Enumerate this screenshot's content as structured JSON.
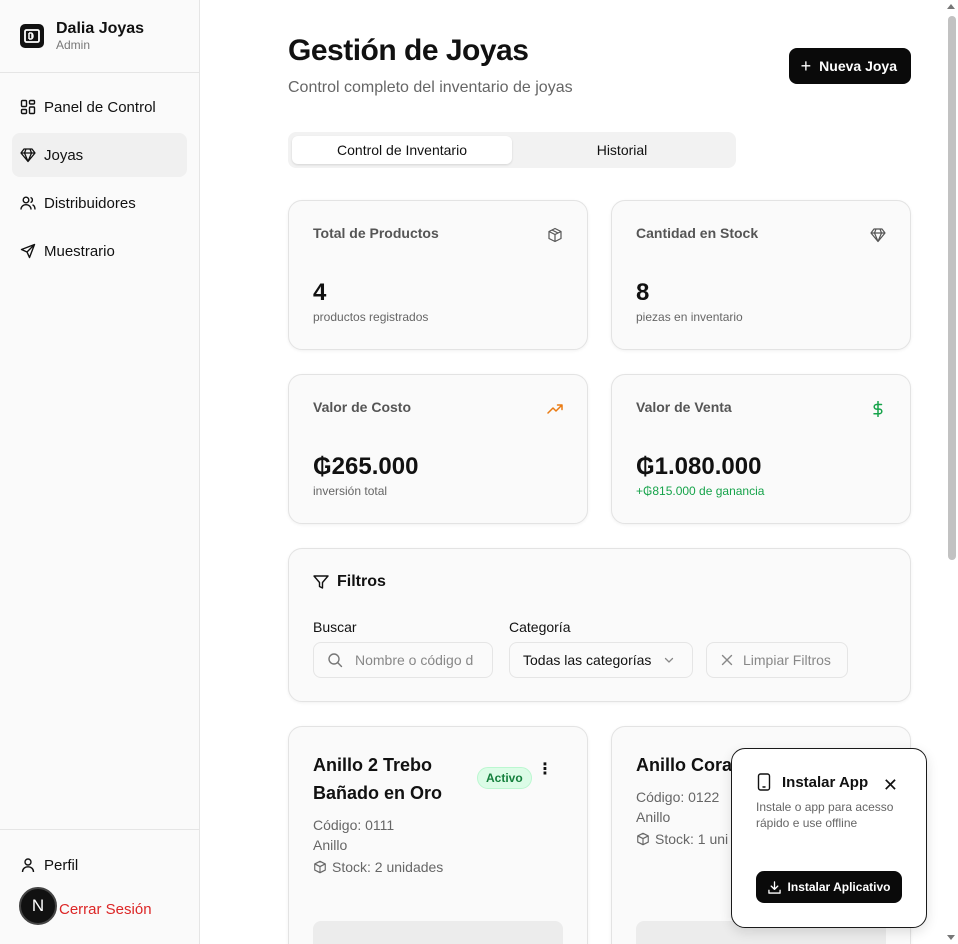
{
  "sidebar": {
    "brand_name": "Dalia Joyas",
    "brand_role": "Admin",
    "items": [
      {
        "label": "Panel de Control",
        "icon": "layout-grid-icon",
        "active": false
      },
      {
        "label": "Joyas",
        "icon": "gem-icon",
        "active": true
      },
      {
        "label": "Distribuidores",
        "icon": "users-icon",
        "active": false
      },
      {
        "label": "Muestrario",
        "icon": "send-icon",
        "active": false
      }
    ],
    "profile_label": "Perfil",
    "logout_label": "Cerrar Sesión",
    "avatar_letter": "N"
  },
  "header": {
    "title": "Gestión de Joyas",
    "subtitle": "Control completo del inventario de joyas",
    "new_button_label": "Nueva Joya"
  },
  "tabs": [
    {
      "label": "Control de Inventario",
      "active": true
    },
    {
      "label": "Historial",
      "active": false
    }
  ],
  "stats": [
    {
      "label": "Total de Productos",
      "value": "4",
      "note": "productos registrados",
      "icon": "box-icon"
    },
    {
      "label": "Cantidad en Stock",
      "value": "8",
      "note": "piezas en inventario",
      "icon": "gem-icon"
    },
    {
      "label": "Valor de Costo",
      "value": "₲265.000",
      "note": "inversión total",
      "icon": "trending-up-icon"
    },
    {
      "label": "Valor de Venta",
      "value": "₲1.080.000",
      "note": "+₲815.000 de ganancia",
      "icon": "dollar-icon"
    }
  ],
  "filters": {
    "title": "Filtros",
    "search_label": "Buscar",
    "search_placeholder": "Nombre o código d",
    "category_label": "Categoría",
    "category_value": "Todas las categorías",
    "clear_label": "Limpiar Filtros"
  },
  "products": [
    {
      "name": "Anillo 2 Trebo Bañado en Oro",
      "badge": "Activo",
      "code": "Código: 0111",
      "category": "Anillo",
      "stock": "Stock: 2 unidades"
    },
    {
      "name": "Anillo Coraz Bañado en I",
      "code": "Código: 0122",
      "category": "Anillo",
      "stock": "Stock: 1 uni"
    }
  ],
  "install": {
    "title": "Instalar App",
    "description": "Instale o app para acesso rápido e use offline",
    "button_label": "Instalar Aplicativo"
  },
  "colors": {
    "accent_dark": "#0a0a0a",
    "danger": "#dc2626",
    "success": "#16a34a",
    "trend": "#ea7b12"
  }
}
